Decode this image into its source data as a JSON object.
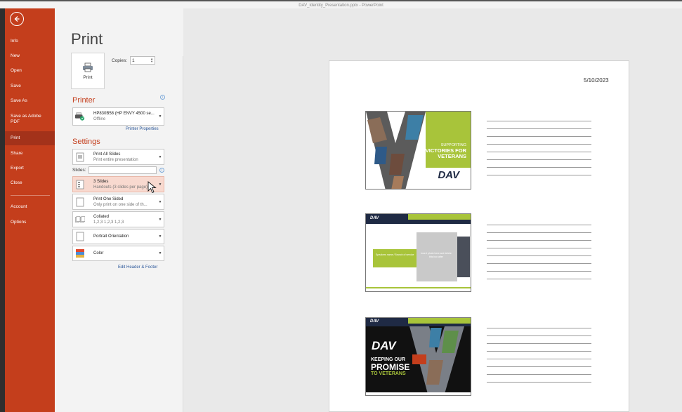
{
  "window": {
    "title": "DAV_Identity_Presentation.pptx - PowerPoint"
  },
  "sidebar": {
    "items": [
      {
        "label": "Info"
      },
      {
        "label": "New"
      },
      {
        "label": "Open"
      },
      {
        "label": "Save"
      },
      {
        "label": "Save As"
      },
      {
        "label": "Save as Adobe PDF"
      },
      {
        "label": "Print",
        "active": true
      },
      {
        "label": "Share"
      },
      {
        "label": "Export"
      },
      {
        "label": "Close"
      },
      {
        "label": "Account"
      },
      {
        "label": "Options"
      }
    ]
  },
  "print": {
    "heading": "Print",
    "button_label": "Print",
    "copies_label": "Copies:",
    "copies_value": "1"
  },
  "printer": {
    "section_title": "Printer",
    "name": "HP830B58 (HP ENVY 4500 se...",
    "status": "Offline",
    "properties_link": "Printer Properties"
  },
  "settings": {
    "section_title": "Settings",
    "slides_range": {
      "main": "Print All Slides",
      "sub": "Print entire presentation"
    },
    "slides_label": "Slides:",
    "slides_value": "",
    "layout": {
      "main": "3 Slides",
      "sub": "Handouts (3 slides per page)"
    },
    "sides": {
      "main": "Print One Sided",
      "sub": "Only print on one side of th..."
    },
    "collation": {
      "main": "Collated",
      "sub": "1,2,3   1,2,3   1,2,3"
    },
    "orientation": {
      "main": "Portrait Orientation"
    },
    "color": {
      "main": "Color"
    },
    "header_footer_link": "Edit Header & Footer"
  },
  "preview": {
    "date": "5/10/2023",
    "slides": [
      {
        "title_line1": "SUPPORTING",
        "title_line2": "VICTORIES FOR",
        "title_line3": "VETERANS",
        "logo": "DAV"
      },
      {
        "logo": "DAV",
        "caption": "Speakers name / Branch of service",
        "placeholder": "Insert photo here and delete this box after"
      },
      {
        "logo": "DAV",
        "line1": "KEEPING OUR",
        "line2": "PROMISE",
        "line3": "TO VETERANS"
      }
    ]
  },
  "colors": {
    "accent": "#c43e1c",
    "dav_green": "#a8c43a",
    "dav_navy": "#1f2a44"
  }
}
